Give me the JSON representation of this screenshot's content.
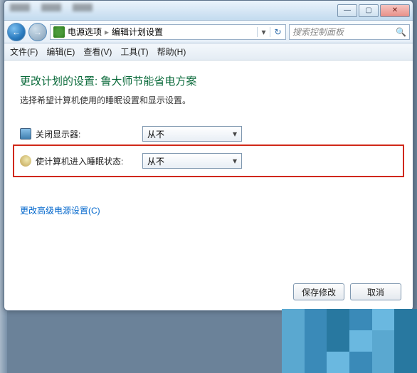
{
  "titlebar": {
    "minimize": "—",
    "maximize": "▢",
    "close": "✕"
  },
  "nav": {
    "back": "←",
    "forward": "→",
    "breadcrumb": {
      "item1": "电源选项",
      "item2": "编辑计划设置"
    },
    "dropdown_glyph": "▾",
    "refresh_glyph": "↻",
    "search_placeholder": "搜索控制面板",
    "search_icon": "🔍"
  },
  "menu": {
    "file": "文件(F)",
    "edit": "编辑(E)",
    "view": "查看(V)",
    "tools": "工具(T)",
    "help": "帮助(H)"
  },
  "page": {
    "heading": "更改计划的设置: 鲁大师节能省电方案",
    "subtext": "选择希望计算机使用的睡眠设置和显示设置。",
    "setting_display": {
      "label": "关闭显示器:",
      "value": "从不"
    },
    "setting_sleep": {
      "label": "使计算机进入睡眠状态:",
      "value": "从不"
    },
    "advanced_link": "更改高级电源设置(C)",
    "save_btn": "保存修改",
    "cancel_btn": "取消"
  }
}
